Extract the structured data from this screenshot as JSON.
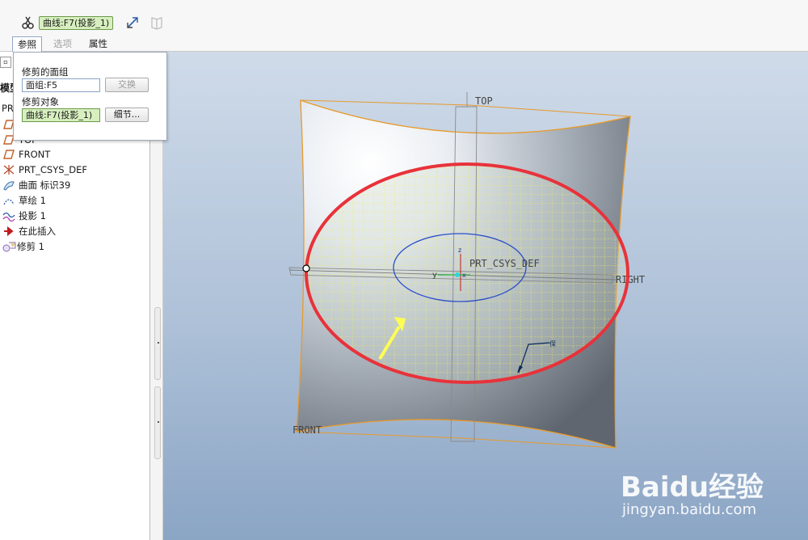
{
  "dashboard": {
    "trim_tool_icon": "scissors-icon",
    "collector_chip": "曲线:F7(投影_1)",
    "flip_icon": "flip-direction-icon",
    "bookmark_icon": "bookmark-icon",
    "tabs": [
      {
        "label": "参照",
        "active": true
      },
      {
        "label": "选项",
        "active": false
      },
      {
        "label": "属性",
        "active": false
      }
    ]
  },
  "references_panel": {
    "trimmed_quilt_label": "修剪的面组",
    "trimmed_quilt_value": "面组:F5",
    "swap_button": "交换",
    "trimming_object_label": "修剪对象",
    "trimming_object_value": "曲线:F7(投影_1)",
    "details_button": "细节..."
  },
  "model_tree": {
    "header_partial": "模型",
    "root_partial": "PR",
    "items": [
      {
        "label": "TOP",
        "icon": "datum-plane-icon"
      },
      {
        "label": "FRONT",
        "icon": "datum-plane-icon"
      },
      {
        "label": "PRT_CSYS_DEF",
        "icon": "csys-icon"
      },
      {
        "label": "曲面 标识39",
        "icon": "surface-icon"
      },
      {
        "label": "草绘 1",
        "icon": "sketch-icon"
      },
      {
        "label": "投影 1",
        "icon": "projection-icon"
      },
      {
        "label": "在此插入",
        "icon": "insert-here-arrow-icon"
      },
      {
        "label": "修剪 1",
        "icon": "trim-feature-icon"
      }
    ]
  },
  "viewport": {
    "datum_labels": {
      "top": "TOP",
      "right": "RIGHT",
      "front": "FRONT",
      "csys": "PRT_CSYS_DEF",
      "y_axis": "y",
      "z_axis": "z",
      "x_axis": "x"
    },
    "trim_curve_color": "#e8323a",
    "grid_color": "#f2ef5a",
    "edge_color": "#e89a2a",
    "direction_arrow_color": "#fdfd55",
    "keep_side_tag": "保"
  },
  "watermark": {
    "logo": "Baidu经验",
    "url": "jingyan.baidu.com"
  }
}
